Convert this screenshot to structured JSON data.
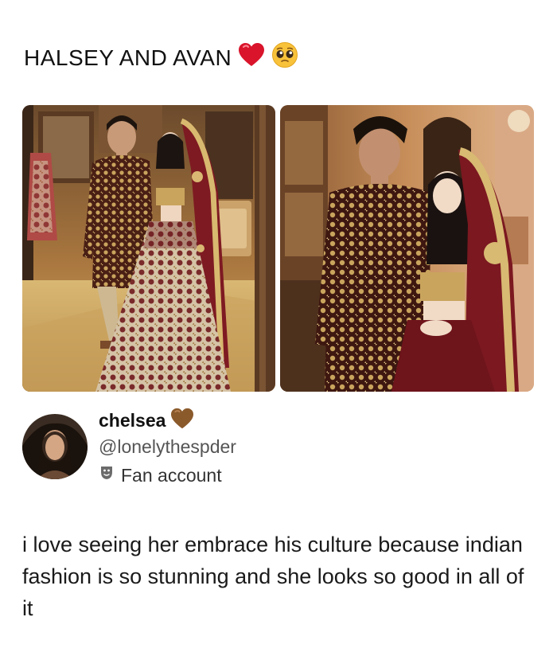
{
  "headline": {
    "text": "HALSEY AND AVAN",
    "emojis": [
      "red-heart-icon",
      "pleading-face-icon"
    ]
  },
  "photos": [
    {
      "name": "photo-left",
      "description_icon": "couple-photo-mirror"
    },
    {
      "name": "photo-right",
      "description_icon": "couple-photo-closeup"
    }
  ],
  "post": {
    "display_name": "chelsea",
    "name_emoji": "brown-heart-icon",
    "handle": "@lonelythespder",
    "badge_label": "Fan account",
    "badge_icon": "theater-masks-icon",
    "text": "i love seeing her embrace his culture because indian fashion is so stunning and she looks so good in all of it"
  },
  "colors": {
    "heart_red": "#d9142b",
    "heart_brown": "#8b5a2b",
    "text_dark": "#111111",
    "text_muted": "#555555"
  }
}
